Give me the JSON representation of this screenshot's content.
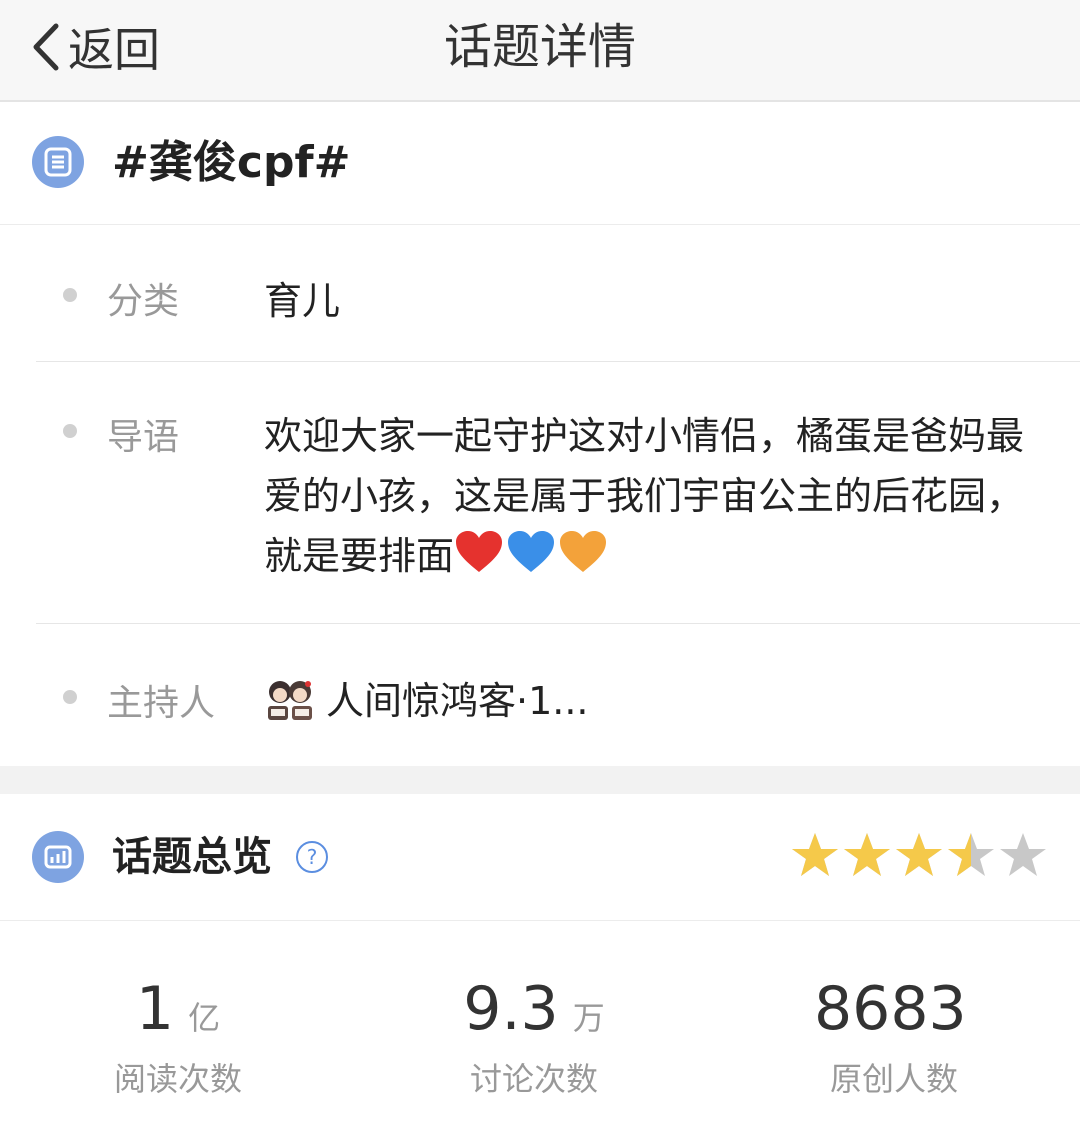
{
  "nav": {
    "back_label": "返回",
    "title": "话题详情"
  },
  "topic": {
    "title": "#龚俊cpf#"
  },
  "info": {
    "category_label": "分类",
    "category_value": "育儿",
    "intro_label": "导语",
    "intro_text": "欢迎大家一起守护这对小情侣，橘蛋是爸妈最爱的小孩，这是属于我们宇宙公主的后花园，就是要排面",
    "intro_emojis": [
      "red-heart",
      "blue-heart",
      "orange-heart"
    ],
    "host_label": "主持人",
    "host_name": "人间惊鸿客·1..."
  },
  "overview": {
    "title": "话题总览",
    "rating": 3.5,
    "rating_max": 5
  },
  "stats": [
    {
      "value": "1",
      "unit": "亿",
      "label": "阅读次数"
    },
    {
      "value": "9.3",
      "unit": "万",
      "label": "讨论次数"
    },
    {
      "value": "8683",
      "unit": "",
      "label": "原创人数"
    }
  ],
  "colors": {
    "accent_blue": "#7ea3e1",
    "star_gold": "#f5c94a",
    "star_gray": "#c8c8c8",
    "heart_red": "#e5322e",
    "heart_blue": "#3a8fe8",
    "heart_orange": "#f3a23a"
  }
}
